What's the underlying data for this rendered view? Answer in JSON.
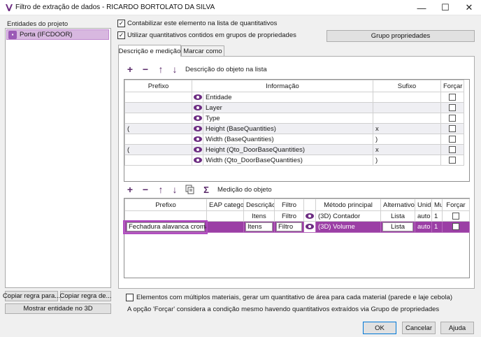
{
  "window": {
    "title": "Filtro de extração de dados - RICARDO BORTOLATO DA SILVA",
    "minimize": "—",
    "maximize": "☐",
    "close": "✕"
  },
  "left": {
    "label": "Entidades do projeto",
    "items": [
      {
        "label": "Porta (IFCDOOR)"
      }
    ],
    "copy_rule_1": "Copiar regra para...",
    "copy_rule_2": "Copiar regra de...",
    "show_3d": "Mostrar entidade no 3D"
  },
  "options": {
    "count_label": "Contabilizar este elemento na lista de quantitativos",
    "use_groups_label": "Utilizar quantitativos contidos em grupos de propriedades",
    "group_button": "Grupo propriedades"
  },
  "tabs": [
    {
      "label": "Descrição e medição"
    },
    {
      "label": "Marcar como"
    }
  ],
  "description": {
    "toolbar_label": "Descrição do objeto na lista",
    "columns": [
      "Prefixo",
      "Informação",
      "Sufixo",
      "Forçar"
    ],
    "rows": [
      {
        "prefix": "",
        "info": "Entidade",
        "suffix": ""
      },
      {
        "prefix": "",
        "info": "Layer",
        "suffix": ""
      },
      {
        "prefix": "",
        "info": "Type",
        "suffix": ""
      },
      {
        "prefix": "(",
        "info": "Height (BaseQuantities)",
        "suffix": "x"
      },
      {
        "prefix": "",
        "info": "Width (BaseQuantities)",
        "suffix": ")"
      },
      {
        "prefix": "(",
        "info": "Height (Qto_DoorBaseQuantities)",
        "suffix": "x"
      },
      {
        "prefix": "",
        "info": "Width (Qto_DoorBaseQuantities)",
        "suffix": ")"
      }
    ]
  },
  "measurement": {
    "toolbar_label": "Medição do objeto",
    "columns": [
      "Prefixo",
      "EAP categori",
      "Descrição",
      "Filtro",
      "",
      "Método principal",
      "Alternativo",
      "Unid",
      "Mu",
      "Forçar"
    ],
    "rows": [
      {
        "prefix": "",
        "eap": "",
        "desc": "Itens",
        "filter": "Filtro",
        "method": "(3D) Contador",
        "alt": "Lista",
        "unit": "auto",
        "mult": "1"
      },
      {
        "prefix": "Fechadura alavanca cromada",
        "eap": "",
        "desc": "Itens",
        "filter": "Filtro",
        "method": "(3D) Volume",
        "alt": "Lista",
        "unit": "auto",
        "mult": "1"
      }
    ]
  },
  "footer": {
    "materials_label": "Elementos com múltiplos materiais, gerar um quantitativo de área para cada material (parede e laje cebola)",
    "note": "A opção 'Forçar' considera a condição mesmo havendo quantitativos extraídos via Grupo de propriedades"
  },
  "buttons": {
    "ok": "OK",
    "cancel": "Cancelar",
    "help": "Ajuda"
  },
  "colors": {
    "accent": "#9b3fa5",
    "highlight_border": "#b04cc0"
  }
}
